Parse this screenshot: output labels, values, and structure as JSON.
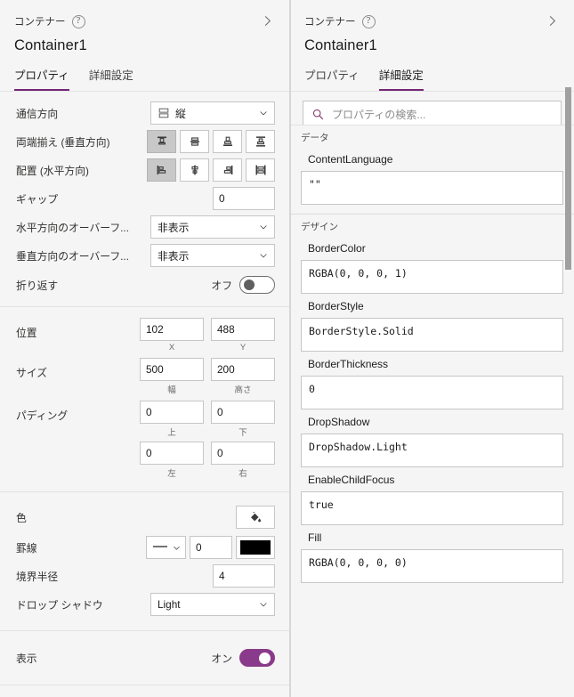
{
  "left_panel": {
    "breadcrumb": "コンテナー",
    "help_icon": "help-circle-icon",
    "collapse_icon": "chevron-right-icon",
    "title": "Container1",
    "tabs": [
      {
        "label": "プロパティ",
        "active": true
      },
      {
        "label": "詳細設定",
        "active": false
      }
    ],
    "layout_section": {
      "direction": {
        "label": "通信方向",
        "value": "縦",
        "icon": "layout-vertical-icon"
      },
      "justify": {
        "label": "両端揃え (垂直方向)",
        "options": [
          "justify-top-icon",
          "justify-center-icon",
          "justify-bottom-icon",
          "justify-space-between-icon"
        ],
        "selected_index": 0
      },
      "align": {
        "label": "配置 (水平方向)",
        "options": [
          "align-left-icon",
          "align-center-icon",
          "align-right-icon",
          "align-stretch-icon"
        ],
        "selected_index": 0
      },
      "gap": {
        "label": "ギャップ",
        "value": "0"
      },
      "overflow_x": {
        "label": "水平方向のオーバーフ...",
        "value": "非表示"
      },
      "overflow_y": {
        "label": "垂直方向のオーバーフ...",
        "value": "非表示"
      },
      "wrap": {
        "label": "折り返す",
        "state_label": "オフ",
        "on": false
      }
    },
    "geometry_section": {
      "position": {
        "label": "位置",
        "x": {
          "value": "102",
          "caption": "X"
        },
        "y": {
          "value": "488",
          "caption": "Y"
        }
      },
      "size": {
        "label": "サイズ",
        "width": {
          "value": "500",
          "caption": "幅"
        },
        "height": {
          "value": "200",
          "caption": "高さ"
        }
      },
      "padding": {
        "label": "パディング",
        "top": {
          "value": "0",
          "caption": "上"
        },
        "bottom": {
          "value": "0",
          "caption": "下"
        },
        "left": {
          "value": "0",
          "caption": "左"
        },
        "right": {
          "value": "0",
          "caption": "右"
        }
      }
    },
    "style_section": {
      "color": {
        "label": "色",
        "icon": "paint-bucket-icon"
      },
      "border": {
        "label": "罫線",
        "style_icon": "solid-line-icon",
        "thickness": "0",
        "color_hex": "#000000"
      },
      "border_radius": {
        "label": "境界半径",
        "value": "4"
      },
      "drop_shadow": {
        "label": "ドロップ シャドウ",
        "value": "Light"
      }
    },
    "visible_section": {
      "label": "表示",
      "state_label": "オン",
      "on": true
    }
  },
  "right_panel": {
    "breadcrumb": "コンテナー",
    "help_icon": "help-circle-icon",
    "collapse_icon": "chevron-right-icon",
    "title": "Container1",
    "tabs": [
      {
        "label": "プロパティ",
        "active": false
      },
      {
        "label": "詳細設定",
        "active": true
      }
    ],
    "search": {
      "icon": "search-icon",
      "placeholder": "プロパティの検索...",
      "value": ""
    },
    "groups": [
      {
        "name": "データ",
        "properties": [
          {
            "label": "ContentLanguage",
            "value": "\"\""
          }
        ]
      },
      {
        "name": "デザイン",
        "properties": [
          {
            "label": "BorderColor",
            "value": "RGBA(0, 0, 0, 1)"
          },
          {
            "label": "BorderStyle",
            "value": "BorderStyle.Solid"
          },
          {
            "label": "BorderThickness",
            "value": "0"
          },
          {
            "label": "DropShadow",
            "value": "DropShadow.Light"
          },
          {
            "label": "EnableChildFocus",
            "value": "true"
          },
          {
            "label": "Fill",
            "value": "RGBA(0, 0, 0, 0)"
          }
        ]
      }
    ],
    "scrollbar": "vertical-scrollbar"
  },
  "theme": {
    "accent": "#742774",
    "toggle_on": "#8a3a8a",
    "panel_bg": "#f5f5f5",
    "input_bg": "#ffffff",
    "border": "#c8c6c4"
  }
}
